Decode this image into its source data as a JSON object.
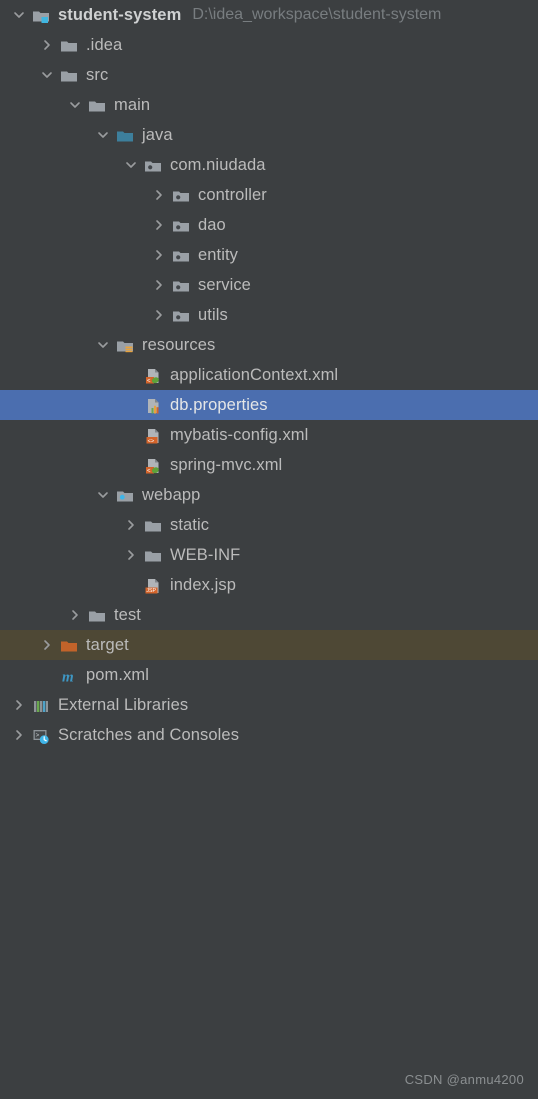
{
  "window": {
    "background_color": "#3c3f41",
    "selection_color": "#4b6eaf",
    "excluded_color": "#4e4835",
    "text_color": "#bbbbbb"
  },
  "project": {
    "name": "student-system",
    "path": "D:\\idea_workspace\\student-system"
  },
  "watermark": "CSDN @anmu4200",
  "tree": {
    "rows": [
      {
        "label": "student-system",
        "subtitle": "D:\\idea_workspace\\student-system",
        "icon": "project-folder-icon",
        "arrow": "expanded",
        "depth": 0,
        "state": "normal",
        "bold": true
      },
      {
        "label": ".idea",
        "icon": "folder-icon",
        "arrow": "collapsed",
        "depth": 1,
        "state": "normal"
      },
      {
        "label": "src",
        "icon": "folder-icon",
        "arrow": "expanded",
        "depth": 1,
        "state": "normal"
      },
      {
        "label": "main",
        "icon": "folder-icon",
        "arrow": "expanded",
        "depth": 2,
        "state": "normal"
      },
      {
        "label": "java",
        "icon": "source-root-icon",
        "arrow": "expanded",
        "depth": 3,
        "state": "normal"
      },
      {
        "label": "com.niudada",
        "icon": "package-icon",
        "arrow": "expanded",
        "depth": 4,
        "state": "normal"
      },
      {
        "label": "controller",
        "icon": "package-icon",
        "arrow": "collapsed",
        "depth": 5,
        "state": "normal"
      },
      {
        "label": "dao",
        "icon": "package-icon",
        "arrow": "collapsed",
        "depth": 5,
        "state": "normal"
      },
      {
        "label": "entity",
        "icon": "package-icon",
        "arrow": "collapsed",
        "depth": 5,
        "state": "normal"
      },
      {
        "label": "service",
        "icon": "package-icon",
        "arrow": "collapsed",
        "depth": 5,
        "state": "normal"
      },
      {
        "label": "utils",
        "icon": "package-icon",
        "arrow": "collapsed",
        "depth": 5,
        "state": "normal"
      },
      {
        "label": "resources",
        "icon": "resource-root-icon",
        "arrow": "expanded",
        "depth": 3,
        "state": "normal"
      },
      {
        "label": "applicationContext.xml",
        "icon": "spring-xml-icon",
        "arrow": "none",
        "depth": 4,
        "state": "normal"
      },
      {
        "label": "db.properties",
        "icon": "properties-file-icon",
        "arrow": "none",
        "depth": 4,
        "state": "selected"
      },
      {
        "label": "mybatis-config.xml",
        "icon": "xml-file-icon",
        "arrow": "none",
        "depth": 4,
        "state": "normal"
      },
      {
        "label": "spring-mvc.xml",
        "icon": "spring-xml-icon",
        "arrow": "none",
        "depth": 4,
        "state": "normal"
      },
      {
        "label": "webapp",
        "icon": "web-root-icon",
        "arrow": "expanded",
        "depth": 3,
        "state": "normal"
      },
      {
        "label": "static",
        "icon": "folder-icon",
        "arrow": "collapsed",
        "depth": 4,
        "state": "normal"
      },
      {
        "label": "WEB-INF",
        "icon": "folder-icon",
        "arrow": "collapsed",
        "depth": 4,
        "state": "normal"
      },
      {
        "label": "index.jsp",
        "icon": "jsp-file-icon",
        "arrow": "none",
        "depth": 4,
        "state": "normal"
      },
      {
        "label": "test",
        "icon": "folder-icon",
        "arrow": "collapsed",
        "depth": 2,
        "state": "normal"
      },
      {
        "label": "target",
        "icon": "excluded-folder-icon",
        "arrow": "collapsed",
        "depth": 1,
        "state": "excluded"
      },
      {
        "label": "pom.xml",
        "icon": "maven-icon",
        "arrow": "none",
        "depth": 1,
        "state": "normal"
      },
      {
        "label": "External Libraries",
        "icon": "library-icon",
        "arrow": "collapsed",
        "depth": 0,
        "state": "normal"
      },
      {
        "label": "Scratches and Consoles",
        "icon": "scratches-icon",
        "arrow": "collapsed",
        "depth": 0,
        "state": "normal"
      }
    ]
  }
}
